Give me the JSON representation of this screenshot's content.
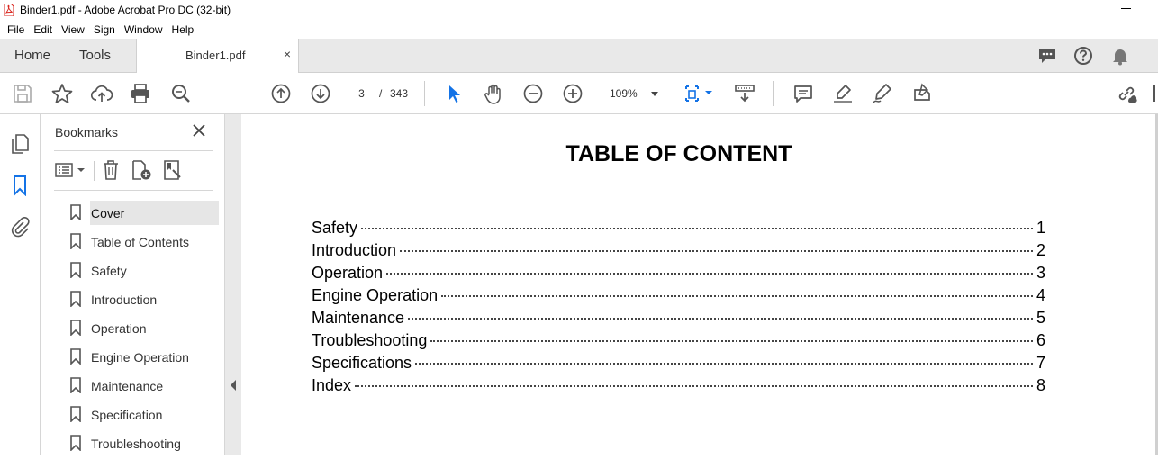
{
  "window": {
    "title": "Binder1.pdf - Adobe Acrobat Pro DC (32-bit)"
  },
  "menu": [
    "File",
    "Edit",
    "View",
    "Sign",
    "Window",
    "Help"
  ],
  "tabs": {
    "home": "Home",
    "tools": "Tools",
    "document": "Binder1.pdf",
    "close": "×"
  },
  "toolbar": {
    "current_page": "3",
    "page_separator": "/",
    "total_pages": "343",
    "zoom": "109%"
  },
  "bookmarks_panel": {
    "title": "Bookmarks",
    "items": [
      {
        "label": "Cover",
        "selected": true
      },
      {
        "label": "Table of Contents"
      },
      {
        "label": "Safety"
      },
      {
        "label": "Introduction"
      },
      {
        "label": "Operation"
      },
      {
        "label": "Engine Operation"
      },
      {
        "label": "Maintenance"
      },
      {
        "label": "Specification"
      },
      {
        "label": "Troubleshooting"
      }
    ]
  },
  "document": {
    "heading": "TABLE OF CONTENT",
    "toc": [
      {
        "title": "Safety",
        "page": "1"
      },
      {
        "title": "Introduction",
        "page": "2"
      },
      {
        "title": "Operation",
        "page": "3"
      },
      {
        "title": "Engine Operation",
        "page": "4"
      },
      {
        "title": "Maintenance",
        "page": "5"
      },
      {
        "title": "Troubleshooting",
        "page": "6"
      },
      {
        "title": "Specifications",
        "page": "7"
      },
      {
        "title": "Index",
        "page": "8"
      }
    ]
  },
  "colors": {
    "accent_blue": "#1473e6",
    "pdf_red": "#d9251d",
    "bookmark_blue": "#1473e6"
  }
}
